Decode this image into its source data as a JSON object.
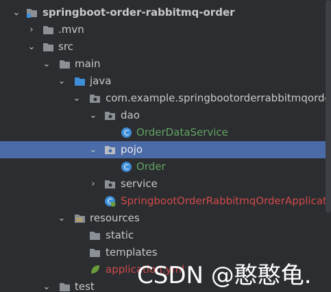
{
  "tree": {
    "project": "springboot-order-rabbitmq-order",
    "mvn": ".mvn",
    "src": "src",
    "main": "main",
    "java": "java",
    "package": "com.example.springbootorderrabbitmqorde",
    "dao": "dao",
    "order_data_service": "OrderDataService",
    "pojo": "pojo",
    "order": "Order",
    "service": "service",
    "app_class": "SpringbootOrderRabbitmqOrderApplicati",
    "resources": "resources",
    "static": "static",
    "templates": "templates",
    "application": "application.yml",
    "test": "test"
  },
  "watermark": "CSDN @憨憨龟.",
  "colors": {
    "background": "#2b2d30",
    "selection": "#4a6aa8",
    "folder": "#8a9096",
    "class": "#3d8fd8",
    "class_name": "#62a462",
    "spring_class": "#d14a4a"
  }
}
